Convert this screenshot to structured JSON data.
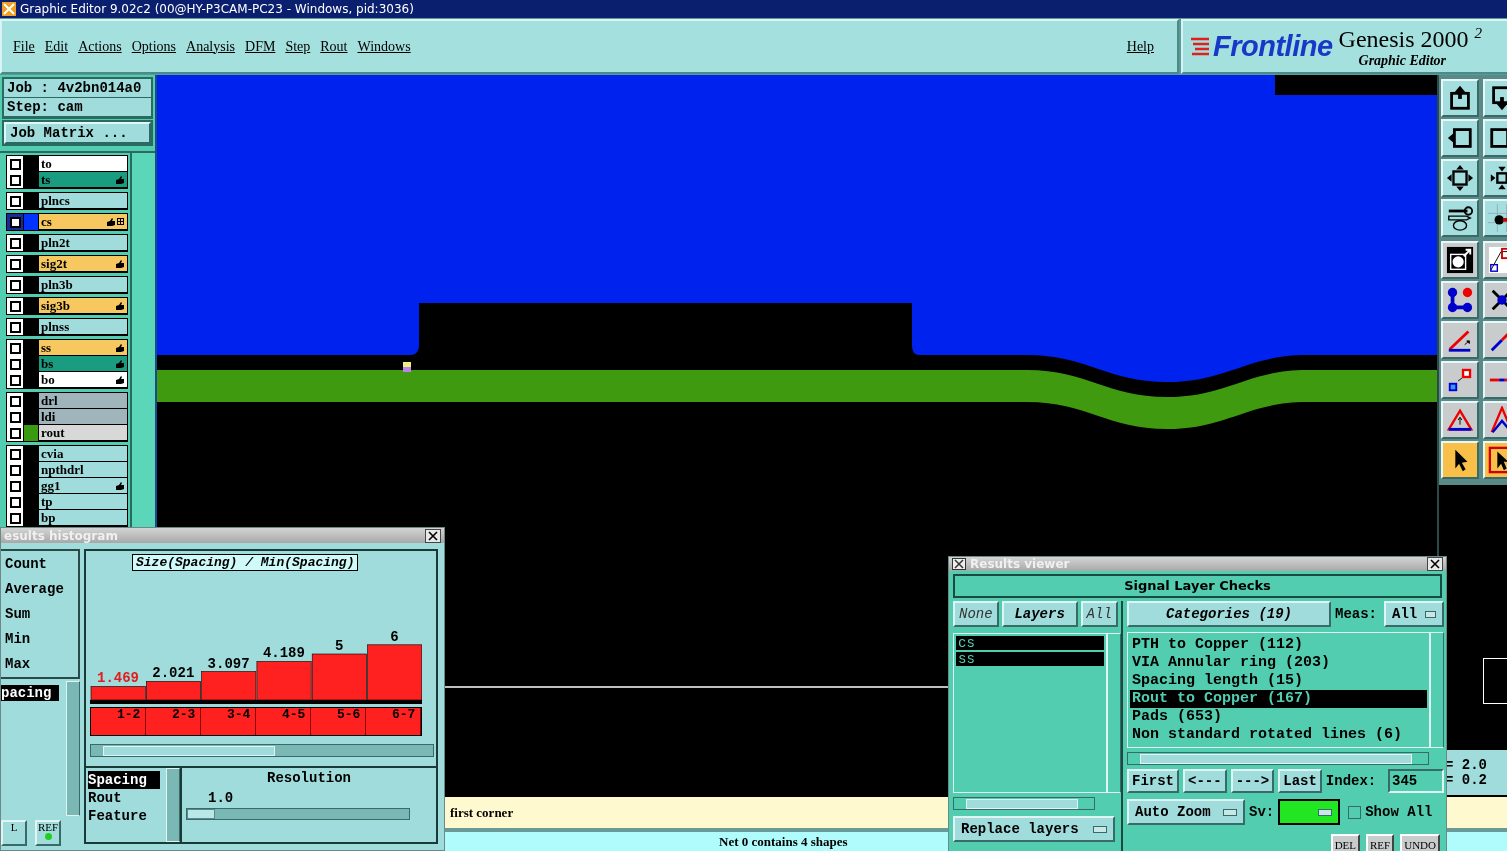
{
  "window": {
    "title": "Graphic Editor 9.02c2 (00@HY-P3CAM-PC23 - Windows, pid:3036)"
  },
  "menu": {
    "items": [
      "File",
      "Edit",
      "Actions",
      "Options",
      "Analysis",
      "DFM",
      "Step",
      "Rout",
      "Windows"
    ],
    "help": "Help"
  },
  "logo": {
    "brand": "Frontline",
    "product": "Genesis 2000 $^{2}$",
    "subtitle": "Graphic Editor"
  },
  "job_panel": {
    "job": "Job : 4v2bn014a0",
    "step": "Step: cam",
    "matrix_button": "Job Matrix ..."
  },
  "layer_groups": [
    [
      {
        "name": "to",
        "checked": true,
        "color": "#ffffff",
        "affected": false,
        "work": false
      },
      {
        "name": "ts",
        "checked": true,
        "color": "#1a9c80",
        "affected": true,
        "work": false
      }
    ],
    [
      {
        "name": "plncs",
        "checked": true,
        "color": "#a0dcdc",
        "affected": false,
        "work": false
      }
    ],
    [
      {
        "name": "cs",
        "checked": true,
        "color": "#f8c860",
        "affected": true,
        "work": true,
        "swatch": {
          "color": "#0033ff"
        }
      }
    ],
    [
      {
        "name": "pln2t",
        "checked": true,
        "color": "#a0dcdc",
        "affected": false,
        "work": false
      }
    ],
    [
      {
        "name": "sig2t",
        "checked": true,
        "color": "#f8c860",
        "affected": true,
        "work": false
      }
    ],
    [
      {
        "name": "pln3b",
        "checked": true,
        "color": "#a0dcdc",
        "affected": false,
        "work": false
      }
    ],
    [
      {
        "name": "sig3b",
        "checked": true,
        "color": "#f8c860",
        "affected": true,
        "work": false
      }
    ],
    [
      {
        "name": "plnss",
        "checked": true,
        "color": "#a0dcdc",
        "affected": false,
        "work": false
      }
    ],
    [
      {
        "name": "ss",
        "checked": true,
        "color": "#f8c860",
        "affected": true,
        "work": false
      },
      {
        "name": "bs",
        "checked": true,
        "color": "#1a9c80",
        "affected": true,
        "work": false
      },
      {
        "name": "bo",
        "checked": true,
        "color": "#ffffff",
        "affected": true,
        "work": false
      }
    ],
    [
      {
        "name": "drl",
        "checked": true,
        "color": "#a0b4bc",
        "affected": false,
        "work": false
      },
      {
        "name": "ldi",
        "checked": true,
        "color": "#a0b4bc",
        "affected": false,
        "work": false
      },
      {
        "name": "rout",
        "checked": true,
        "color": "#d8d8d8",
        "affected": false,
        "work": false,
        "swatch": {
          "color": "#3a9a10"
        }
      }
    ],
    [
      {
        "name": "cvia",
        "checked": true,
        "color": "#a0dcdc",
        "affected": false,
        "work": false
      },
      {
        "name": "npthdrl",
        "checked": true,
        "color": "#a0dcdc",
        "affected": false,
        "work": false
      },
      {
        "name": "gg1",
        "checked": true,
        "color": "#a0dcdc",
        "affected": true,
        "work": false
      },
      {
        "name": "tp",
        "checked": true,
        "color": "#a0dcdc",
        "affected": false,
        "work": false
      },
      {
        "name": "bp",
        "checked": true,
        "color": "#a0dcdc",
        "affected": false,
        "work": false
      }
    ]
  ],
  "toolbar": {
    "groups": [
      [
        {
          "selected": false
        },
        {
          "selected": false
        },
        {
          "selected": false
        },
        {
          "selected": false
        },
        {
          "selected": false
        },
        {
          "selected": false
        },
        {
          "selected": false
        },
        {
          "selected": false
        }
      ],
      [
        {
          "selected": false
        },
        {
          "selected": false
        },
        {
          "selected": false
        },
        {
          "selected": false
        },
        {
          "selected": false
        },
        {
          "selected": false
        },
        {
          "selected": false
        },
        {
          "selected": false
        },
        {
          "selected": false
        },
        {
          "selected": false
        },
        {
          "selected": true
        },
        {
          "selected": true
        }
      ]
    ]
  },
  "coordinates": [
    "= 2.0",
    "= 0.2"
  ],
  "prompt": "first corner",
  "status_bar": "Net 0 contains 4 shapes",
  "histogram_window": {
    "title": "esults histogram",
    "stats": [
      "Count",
      "Average",
      "Sum",
      "Min",
      "Max"
    ],
    "measures": [
      {
        "label": "pacing",
        "selected": true
      }
    ],
    "buttons": [
      "L",
      "REF"
    ],
    "chart_data": {
      "type": "bar",
      "title": "Size(Spacing) / Min(Spacing)",
      "categories": [
        "1-2",
        "2-3",
        "3-4",
        "4-5",
        "5-6",
        "6-7"
      ],
      "values": [
        1.469,
        2.021,
        3.097,
        4.189,
        5,
        6
      ],
      "data_labels": true
    },
    "types": [
      {
        "label": "Spacing",
        "selected": true
      },
      {
        "label": "Rout",
        "selected": false
      },
      {
        "label": "Feature",
        "selected": false
      }
    ],
    "resolution": {
      "label": "Resolution",
      "value": "1.0",
      "level": 0.0
    }
  },
  "results_viewer": {
    "title": "Results viewer",
    "heading": "Signal Layer Checks",
    "layer_buttons": [
      "None",
      "Layers",
      "All"
    ],
    "layers": [
      {
        "label": "cs",
        "selected": true
      },
      {
        "label": "ss",
        "selected": true
      }
    ],
    "categories_button": "Categories (19)",
    "meas_label": "Meas:",
    "meas_value": "All",
    "categories": [
      {
        "label": "PTH to Copper (112)",
        "selected": false
      },
      {
        "label": "VIA Annular ring (203)",
        "selected": false
      },
      {
        "label": "Spacing length (15)",
        "selected": false
      },
      {
        "label": "Rout to Copper (167)",
        "selected": true
      },
      {
        "label": "Pads (653)",
        "selected": false
      },
      {
        "label": "Non standard rotated lines (6)",
        "selected": false
      }
    ],
    "nav_buttons": [
      "First",
      "<---",
      "--->",
      "Last"
    ],
    "index_label": "Index:",
    "index_value": "345",
    "zoom_mode": "Auto Zoom",
    "sv": {
      "label": "Sv:",
      "color": "#22e622"
    },
    "show_all": {
      "label": "Show All",
      "checked": false
    },
    "replace_mode": "Replace layers",
    "action_buttons": [
      "DEL",
      "REF",
      "UNDO"
    ]
  }
}
